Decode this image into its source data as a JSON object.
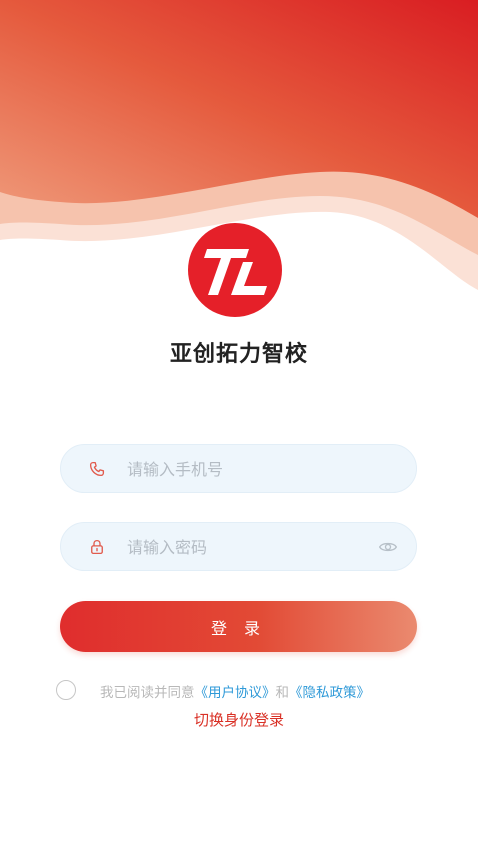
{
  "app": {
    "name": "亚创拓力智校"
  },
  "form": {
    "phone_placeholder": "请输入手机号",
    "password_placeholder": "请输入密码",
    "login_label": "登 录"
  },
  "agreement": {
    "prefix": "我已阅读并同意",
    "user_agreement": "《用户协议》",
    "and": "和",
    "privacy_policy": "《隐私政策》",
    "checked": false
  },
  "switch_role_label": "切换身份登录",
  "icons": {
    "phone": "phone-icon",
    "lock": "lock-icon",
    "eye": "eye-icon",
    "logo": "app-logo"
  },
  "colors": {
    "accent": "#e0282d",
    "link": "#2f9ad8",
    "input_bg": "#eef6fc",
    "placeholder": "#b4bcc4"
  }
}
